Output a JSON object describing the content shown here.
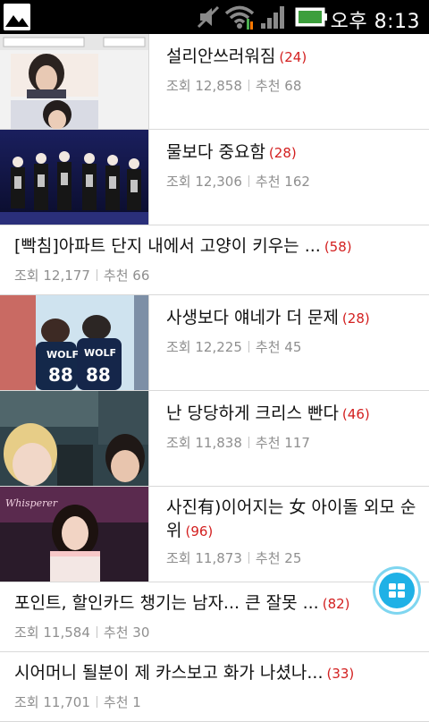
{
  "status_bar": {
    "time": "오후 8:13"
  },
  "articles": [
    {
      "title": "설리안쓰러워짐",
      "comments": "(24)",
      "views_label": "조회",
      "views": "12,858",
      "rec_label": "추천",
      "recs": "68"
    },
    {
      "title": "물보다 중요함",
      "comments": "(28)",
      "views_label": "조회",
      "views": "12,306",
      "rec_label": "추천",
      "recs": "162"
    },
    {
      "title": "[빡침]아파트 단지 내에서 고양이 키우는 ...",
      "comments": "(58)",
      "views_label": "조회",
      "views": "12,177",
      "rec_label": "추천",
      "recs": "66"
    },
    {
      "title": "사생보다 얘네가 더 문제",
      "comments": "(28)",
      "views_label": "조회",
      "views": "12,225",
      "rec_label": "추천",
      "recs": "45"
    },
    {
      "title": "난 당당하게 크리스 빤다",
      "comments": "(46)",
      "views_label": "조회",
      "views": "11,838",
      "rec_label": "추천",
      "recs": "117"
    },
    {
      "title": "사진有)이어지는 女 아이돌 외모 순위",
      "comments": "(96)",
      "views_label": "조회",
      "views": "11,873",
      "rec_label": "추천",
      "recs": "25"
    },
    {
      "title": "포인트, 할인카드 챙기는 남자... 큰 잘못 ...",
      "comments": "(82)",
      "views_label": "조회",
      "views": "11,584",
      "rec_label": "추천",
      "recs": "30"
    },
    {
      "title": "시어머니 될분이 제 카스보고 화가 나셨나...",
      "comments": "(33)",
      "views_label": "조회",
      "views": "11,701",
      "rec_label": "추천",
      "recs": "1"
    }
  ],
  "thumbnail_texts": {
    "jersey_a": "WOLF",
    "jersey_b": "WOLF",
    "num_a": "88",
    "num_b": "88",
    "banner": "Whisperer"
  },
  "colors": {
    "comment_count": "#d32020",
    "fab": "#1fb1e6"
  },
  "icons": {
    "fab": "grid-menu-icon"
  }
}
